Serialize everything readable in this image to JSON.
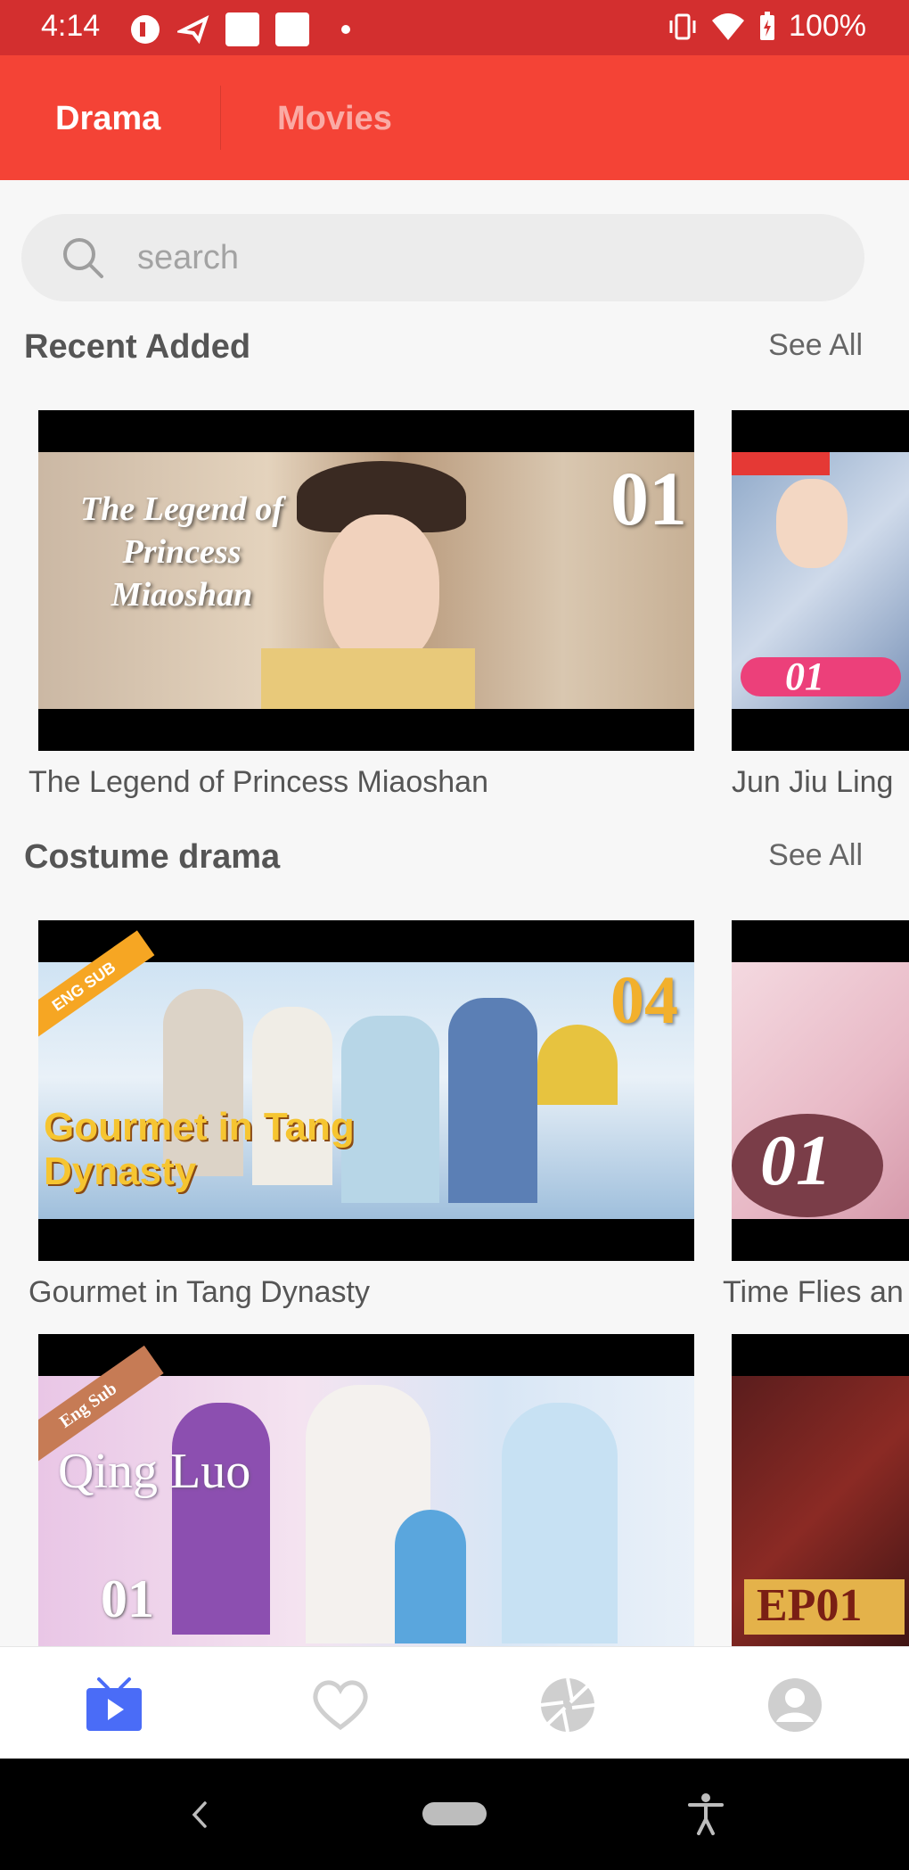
{
  "status_bar": {
    "time": "4:14",
    "battery": "100%"
  },
  "tabs": [
    {
      "label": "Drama",
      "active": true
    },
    {
      "label": "Movies",
      "active": false
    }
  ],
  "search": {
    "placeholder": "search"
  },
  "sections": [
    {
      "title": "Recent Added",
      "see_all": "See All",
      "items": [
        {
          "title": "The Legend of Princess Miaoshan",
          "poster_text": "The Legend of Princess Miaoshan",
          "episode": "01"
        },
        {
          "title": "Jun Jiu Ling",
          "poster_text": "",
          "episode": "01"
        }
      ]
    },
    {
      "title": "Costume drama",
      "see_all": "See All",
      "items": [
        {
          "title": "Gourmet in Tang Dynasty",
          "poster_text": "Gourmet in Tang Dynasty",
          "badge": "ENG SUB",
          "episode": "04"
        },
        {
          "title": "Time Flies an",
          "poster_text": "",
          "episode": "01"
        },
        {
          "title": "",
          "poster_text": "Qing Luo",
          "badge": "Eng Sub",
          "episode": "01"
        },
        {
          "title": "",
          "poster_text": "",
          "episode": "EP01"
        }
      ]
    }
  ],
  "bottom_nav": [
    {
      "icon": "tv-play-icon",
      "active": true
    },
    {
      "icon": "heart-icon",
      "active": false
    },
    {
      "icon": "aperture-icon",
      "active": false
    },
    {
      "icon": "account-icon",
      "active": false
    }
  ],
  "colors": {
    "status_bar": "#d32f2f",
    "app_bar": "#f44336",
    "active_nav": "#4a6cf7",
    "inactive_nav": "#cfcfcf"
  }
}
